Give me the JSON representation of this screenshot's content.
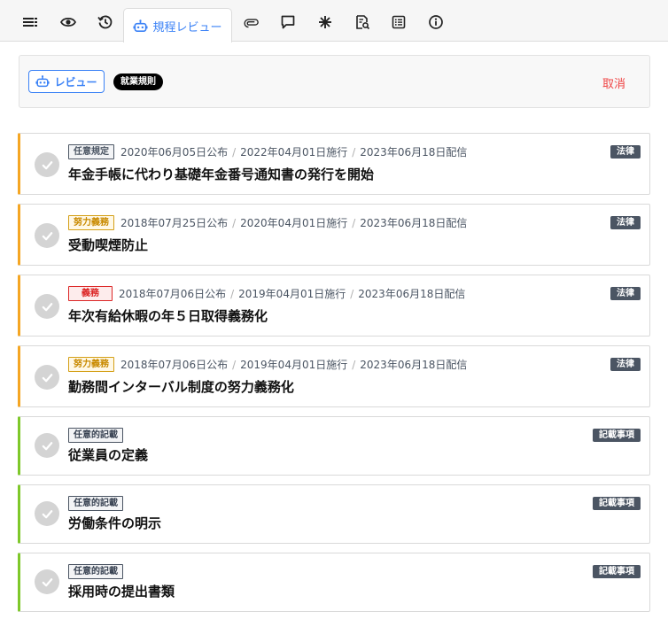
{
  "tabs": {
    "active_label": "規程レビュー",
    "icons": [
      "list-icon",
      "eye-icon",
      "history-icon",
      "robot-icon",
      "paperclip-icon",
      "comment-icon",
      "asterisk-icon",
      "document-search-icon",
      "table-list-icon",
      "info-icon"
    ]
  },
  "review": {
    "button_label": "レビュー",
    "rule_label": "就業規則",
    "cancel_label": "取消"
  },
  "items": [
    {
      "badge": "任意規定",
      "published": "2020年06月05日公布",
      "enforced": "2022年04月01日施行",
      "delivered": "2023年06月18日配信",
      "title": "年金手帳に代わり基礎年金番号通知書の発行を開始",
      "tag": "法律"
    },
    {
      "badge": "努力義務",
      "published": "2018年07月25日公布",
      "enforced": "2020年04月01日施行",
      "delivered": "2023年06月18日配信",
      "title": "受動喫煙防止",
      "tag": "法律"
    },
    {
      "badge": "義務",
      "published": "2018年07月06日公布",
      "enforced": "2019年04月01日施行",
      "delivered": "2023年06月18日配信",
      "title": "年次有給休暇の年５日取得義務化",
      "tag": "法律"
    },
    {
      "badge": "努力義務",
      "published": "2018年07月06日公布",
      "enforced": "2019年04月01日施行",
      "delivered": "2023年06月18日配信",
      "title": "勤務間インターバル制度の努力義務化",
      "tag": "法律"
    },
    {
      "badge": "任意的記載",
      "title": "従業員の定義",
      "tag": "記載事項"
    },
    {
      "badge": "任意的記載",
      "title": "労働条件の明示",
      "tag": "記載事項"
    },
    {
      "badge": "任意的記載",
      "title": "採用時の提出書類",
      "tag": "記載事項"
    }
  ],
  "colors": {
    "accent": "#3b82f6",
    "cancel": "#ef4444",
    "law_border": "#f5a623",
    "record_border": "#7ec82a"
  }
}
